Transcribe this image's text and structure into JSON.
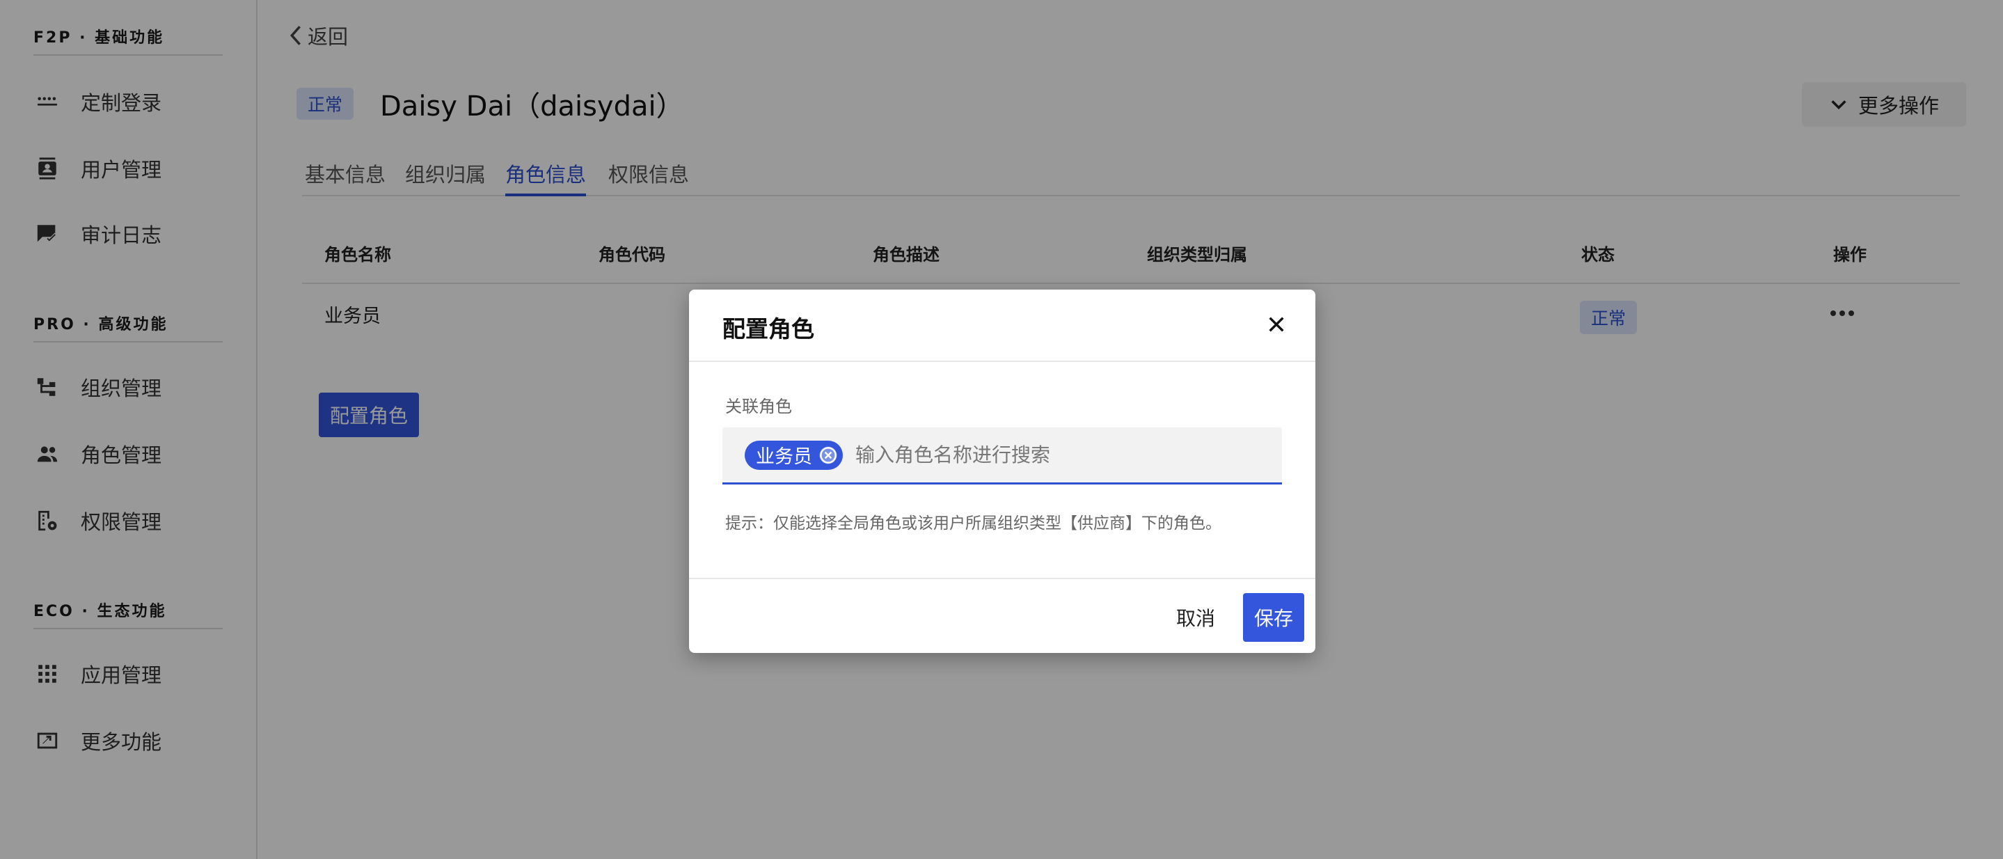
{
  "sidebar": {
    "sections": [
      {
        "title": "F2P · 基础功能",
        "items": [
          {
            "label": "定制登录",
            "icon": "password-dots-icon"
          },
          {
            "label": "用户管理",
            "icon": "contact-card-icon"
          },
          {
            "label": "审计日志",
            "icon": "chat-check-icon"
          }
        ]
      },
      {
        "title": "PRO · 高级功能",
        "items": [
          {
            "label": "组织管理",
            "icon": "org-tree-icon"
          },
          {
            "label": "角色管理",
            "icon": "people-icon"
          },
          {
            "label": "权限管理",
            "icon": "building-settings-icon"
          }
        ]
      },
      {
        "title": "ECO · 生态功能",
        "items": [
          {
            "label": "应用管理",
            "icon": "apps-grid-icon"
          },
          {
            "label": "更多功能",
            "icon": "screen-arrow-icon"
          }
        ]
      }
    ]
  },
  "header": {
    "back_label": "返回",
    "status": "正常",
    "user_title": "Daisy Dai（daisydai）",
    "more_actions": "更多操作"
  },
  "tabs": [
    {
      "label": "基本信息",
      "active": false
    },
    {
      "label": "组织归属",
      "active": false
    },
    {
      "label": "角色信息",
      "active": true
    },
    {
      "label": "权限信息",
      "active": false
    }
  ],
  "table": {
    "columns": [
      "角色名称",
      "角色代码",
      "角色描述",
      "组织类型归属",
      "状态",
      "操作"
    ],
    "rows": [
      {
        "name": "业务员",
        "code": "",
        "desc": "",
        "org_type": "",
        "status": "正常"
      }
    ]
  },
  "config_button": "配置角色",
  "dialog": {
    "title": "配置角色",
    "field_label": "关联角色",
    "selected_chip": "业务员",
    "placeholder": "输入角色名称进行搜索",
    "hint": "提示：仅能选择全局角色或该用户所属组织类型【供应商】下的角色。",
    "cancel": "取消",
    "save": "保存"
  },
  "colors": {
    "primary": "#3356dc",
    "tag_bg": "#dbe4fb",
    "overlay": "rgba(0,0,0,0.40)"
  }
}
